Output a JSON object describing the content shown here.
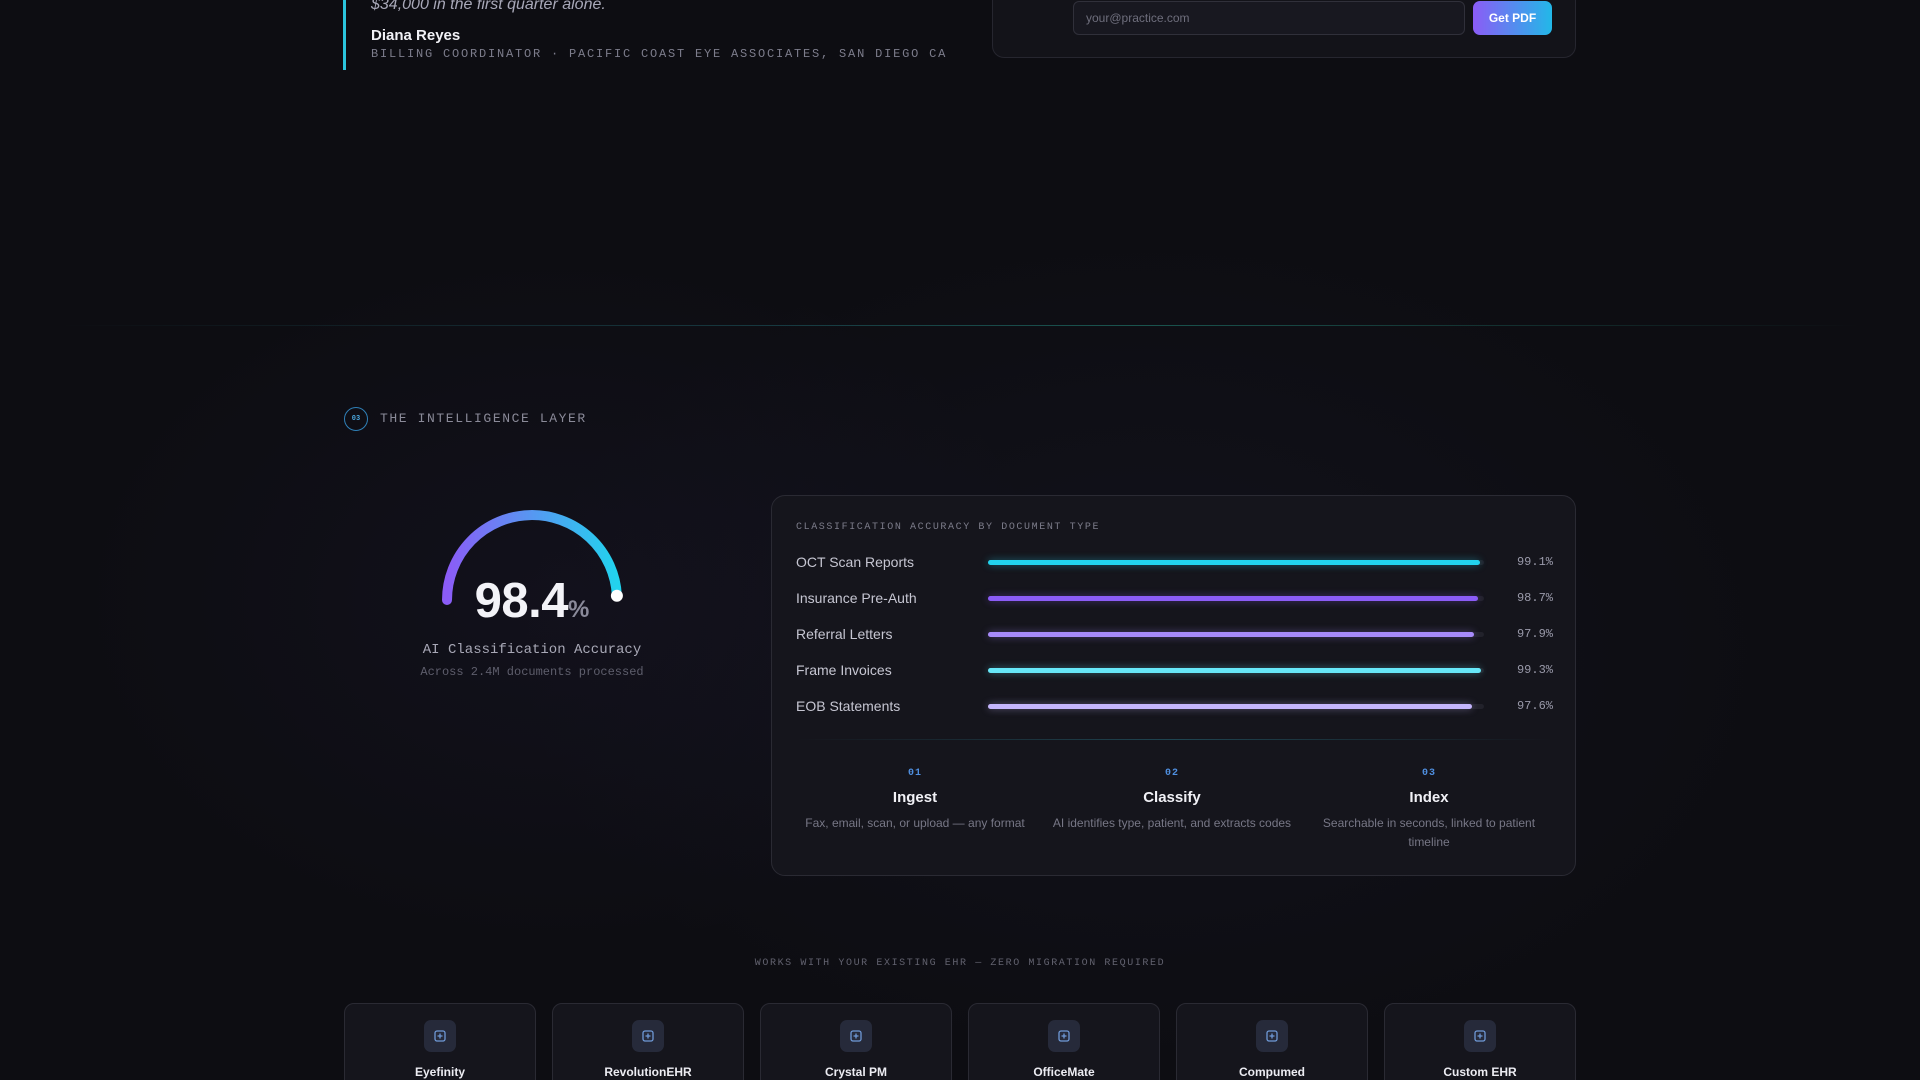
{
  "testimonial": {
    "quote_tail": "$34,000 in the first quarter alone.",
    "author_name": "Diana Reyes",
    "author_role": "BILLING COORDINATOR · PACIFIC COAST EYE ASSOCIATES, SAN DIEGO CA"
  },
  "pdf_form": {
    "email_placeholder": "your@practice.com",
    "button_label": "Get PDF"
  },
  "section": {
    "number": "03",
    "title": "THE INTELLIGENCE LAYER"
  },
  "gauge": {
    "value": "98.4",
    "unit": "%",
    "fraction": 0.984,
    "label": "AI Classification Accuracy",
    "sublabel": "Across 2.4M documents processed",
    "gradient_start": "#8b5cf6",
    "gradient_end": "#22d3ee"
  },
  "accuracy": {
    "heading": "CLASSIFICATION ACCURACY BY DOCUMENT TYPE",
    "rows": [
      {
        "label": "OCT Scan Reports",
        "value_text": "99.1%",
        "value": 99.1,
        "color": "#22d3ee"
      },
      {
        "label": "Insurance Pre-Auth",
        "value_text": "98.7%",
        "value": 98.7,
        "color": "#8b5cf6"
      },
      {
        "label": "Referral Letters",
        "value_text": "97.9%",
        "value": 97.9,
        "color": "#a78bfa"
      },
      {
        "label": "Frame Invoices",
        "value_text": "99.3%",
        "value": 99.3,
        "color": "#67e8f9"
      },
      {
        "label": "EOB Statements",
        "value_text": "97.6%",
        "value": 97.6,
        "color": "#c4b5fd"
      }
    ]
  },
  "steps": [
    {
      "num": "01",
      "title": "Ingest",
      "desc": "Fax, email, scan, or upload — any format"
    },
    {
      "num": "02",
      "title": "Classify",
      "desc": "AI identifies type, patient, and extracts codes"
    },
    {
      "num": "03",
      "title": "Index",
      "desc": "Searchable in seconds, linked to patient timeline"
    }
  ],
  "ehr": {
    "caption": "WORKS WITH YOUR EXISTING EHR — ZERO MIGRATION REQUIRED",
    "systems": [
      "Eyefinity",
      "RevolutionEHR",
      "Crystal PM",
      "OfficeMate",
      "Compumed",
      "Custom EHR"
    ],
    "icon": "plus-square-icon"
  }
}
